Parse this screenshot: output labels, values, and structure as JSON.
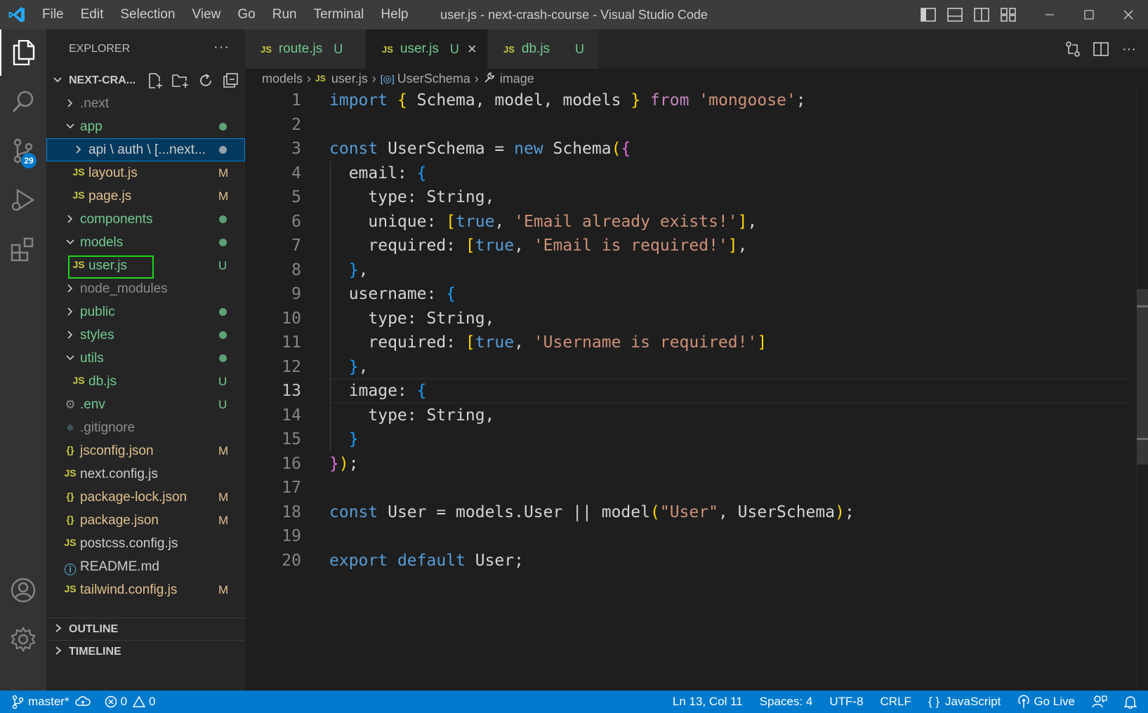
{
  "app": {
    "window_title": "user.js - next-crash-course - Visual Studio Code",
    "menu": [
      "File",
      "Edit",
      "Selection",
      "View",
      "Go",
      "Run",
      "Terminal",
      "Help"
    ]
  },
  "activity_bar": {
    "items": [
      "explorer-icon",
      "search-icon",
      "source-control-icon",
      "run-debug-icon",
      "extensions-icon"
    ],
    "source_control_badge": "29",
    "bottom": [
      "account-icon",
      "settings-gear-icon"
    ]
  },
  "sidebar": {
    "title": "EXPLORER",
    "more": "···",
    "project": "NEXT-CRA...",
    "outline": "OUTLINE",
    "timeline": "TIMELINE",
    "tree": [
      {
        "name": ".next",
        "kind": "folder",
        "expanded": false,
        "depth": 0,
        "status": "",
        "color": "gray"
      },
      {
        "name": "app",
        "kind": "folder",
        "expanded": true,
        "depth": 0,
        "status": "dot",
        "color": "green"
      },
      {
        "name": "api \\ auth \\ [...next...",
        "kind": "folder",
        "expanded": false,
        "depth": 1,
        "status": "dot",
        "color": "white",
        "selected": true
      },
      {
        "name": "layout.js",
        "kind": "js",
        "depth": 1,
        "status": "M",
        "color": "mod"
      },
      {
        "name": "page.js",
        "kind": "js",
        "depth": 1,
        "status": "M",
        "color": "mod"
      },
      {
        "name": "components",
        "kind": "folder",
        "expanded": false,
        "depth": 0,
        "status": "dot",
        "color": "green"
      },
      {
        "name": "models",
        "kind": "folder",
        "expanded": true,
        "depth": 0,
        "status": "dot",
        "color": "green"
      },
      {
        "name": "user.js",
        "kind": "js",
        "depth": 1,
        "status": "U",
        "color": "green",
        "boxed": true
      },
      {
        "name": "node_modules",
        "kind": "folder",
        "expanded": false,
        "depth": 0,
        "status": "",
        "color": "gray"
      },
      {
        "name": "public",
        "kind": "folder",
        "expanded": false,
        "depth": 0,
        "status": "dot",
        "color": "green"
      },
      {
        "name": "styles",
        "kind": "folder",
        "expanded": false,
        "depth": 0,
        "status": "dot",
        "color": "green"
      },
      {
        "name": "utils",
        "kind": "folder",
        "expanded": true,
        "depth": 0,
        "status": "dot",
        "color": "green"
      },
      {
        "name": "db.js",
        "kind": "js",
        "depth": 1,
        "status": "U",
        "color": "green"
      },
      {
        "name": ".env",
        "kind": "gear",
        "depth": 0,
        "status": "U",
        "color": "green"
      },
      {
        "name": ".gitignore",
        "kind": "git",
        "depth": 0,
        "status": "",
        "color": "gray"
      },
      {
        "name": "jsconfig.json",
        "kind": "json",
        "depth": 0,
        "status": "M",
        "color": "mod"
      },
      {
        "name": "next.config.js",
        "kind": "js",
        "depth": 0,
        "status": "",
        "color": "white"
      },
      {
        "name": "package-lock.json",
        "kind": "json",
        "depth": 0,
        "status": "M",
        "color": "mod"
      },
      {
        "name": "package.json",
        "kind": "json",
        "depth": 0,
        "status": "M",
        "color": "mod"
      },
      {
        "name": "postcss.config.js",
        "kind": "js",
        "depth": 0,
        "status": "",
        "color": "white"
      },
      {
        "name": "README.md",
        "kind": "info",
        "depth": 0,
        "status": "",
        "color": "white"
      },
      {
        "name": "tailwind.config.js",
        "kind": "js",
        "depth": 0,
        "status": "M",
        "color": "mod"
      }
    ]
  },
  "tabs": [
    {
      "icon": "JS",
      "name": "route.js",
      "status": "U",
      "active": false
    },
    {
      "icon": "JS",
      "name": "user.js",
      "status": "U",
      "active": true,
      "close": "×"
    },
    {
      "icon": "JS",
      "name": "db.js",
      "status": "U",
      "active": false
    }
  ],
  "breadcrumb": {
    "folder": "models",
    "file": "user.js",
    "symbol": "UserSchema",
    "property": "image"
  },
  "editor": {
    "current_line": 13,
    "lines": [
      [
        [
          "k",
          "import"
        ],
        [
          "v",
          " "
        ],
        [
          "b1",
          "{"
        ],
        [
          "v",
          " Schema, model, models "
        ],
        [
          "b1",
          "}"
        ],
        [
          "v",
          " "
        ],
        [
          "kc",
          "from"
        ],
        [
          "v",
          " "
        ],
        [
          "s",
          "'mongoose'"
        ],
        [
          "v",
          ";"
        ]
      ],
      [],
      [
        [
          "k",
          "const"
        ],
        [
          "v",
          " UserSchema = "
        ],
        [
          "k",
          "new"
        ],
        [
          "v",
          " Schema"
        ],
        [
          "b1",
          "("
        ],
        [
          "b2",
          "{"
        ]
      ],
      [
        [
          "v",
          "  email: "
        ],
        [
          "b3",
          "{"
        ]
      ],
      [
        [
          "v",
          "    type: String,"
        ]
      ],
      [
        [
          "v",
          "    unique: "
        ],
        [
          "b1",
          "["
        ],
        [
          "k",
          "true"
        ],
        [
          "v",
          ", "
        ],
        [
          "s",
          "'Email already exists!'"
        ],
        [
          "b1",
          "]"
        ],
        [
          "v",
          ","
        ]
      ],
      [
        [
          "v",
          "    required: "
        ],
        [
          "b1",
          "["
        ],
        [
          "k",
          "true"
        ],
        [
          "v",
          ", "
        ],
        [
          "s",
          "'Email is required!'"
        ],
        [
          "b1",
          "]"
        ],
        [
          "v",
          ","
        ]
      ],
      [
        [
          "v",
          "  "
        ],
        [
          "b3",
          "}"
        ],
        [
          "v",
          ","
        ]
      ],
      [
        [
          "v",
          "  username: "
        ],
        [
          "b3",
          "{"
        ]
      ],
      [
        [
          "v",
          "    type: String,"
        ]
      ],
      [
        [
          "v",
          "    required: "
        ],
        [
          "b1",
          "["
        ],
        [
          "k",
          "true"
        ],
        [
          "v",
          ", "
        ],
        [
          "s",
          "'Username is required!'"
        ],
        [
          "b1",
          "]"
        ]
      ],
      [
        [
          "v",
          "  "
        ],
        [
          "b3",
          "}"
        ],
        [
          "v",
          ","
        ]
      ],
      [
        [
          "v",
          "  image: "
        ],
        [
          "b3",
          "{"
        ]
      ],
      [
        [
          "v",
          "    type: String,"
        ]
      ],
      [
        [
          "v",
          "  "
        ],
        [
          "b3",
          "}"
        ]
      ],
      [
        [
          "b2",
          "}"
        ],
        [
          "b1",
          ")"
        ],
        [
          "v",
          ";"
        ]
      ],
      [],
      [
        [
          "k",
          "const"
        ],
        [
          "v",
          " User = models.User || model"
        ],
        [
          "b1",
          "("
        ],
        [
          "s",
          "\"User\""
        ],
        [
          "v",
          ", UserSchema"
        ],
        [
          "b1",
          ")"
        ],
        [
          "v",
          ";"
        ]
      ],
      [],
      [
        [
          "k",
          "export"
        ],
        [
          "v",
          " "
        ],
        [
          "k",
          "default"
        ],
        [
          "v",
          " User;"
        ]
      ]
    ]
  },
  "status_bar": {
    "branch": "master*",
    "errors": "0",
    "warnings": "0",
    "position": "Ln 13, Col 11",
    "spaces": "Spaces: 4",
    "encoding": "UTF-8",
    "eol": "CRLF",
    "language": "JavaScript",
    "language_prefix": "{ }",
    "golive": "Go Live"
  },
  "colors": {
    "accent": "#007acc",
    "titlebar": "#3c3c3c",
    "activitybar": "#333333",
    "sidebar": "#252526",
    "editor": "#1e1e1e",
    "untracked": "#73c991",
    "modified": "#e2c08d",
    "highlight_box": "#1dd61d"
  }
}
